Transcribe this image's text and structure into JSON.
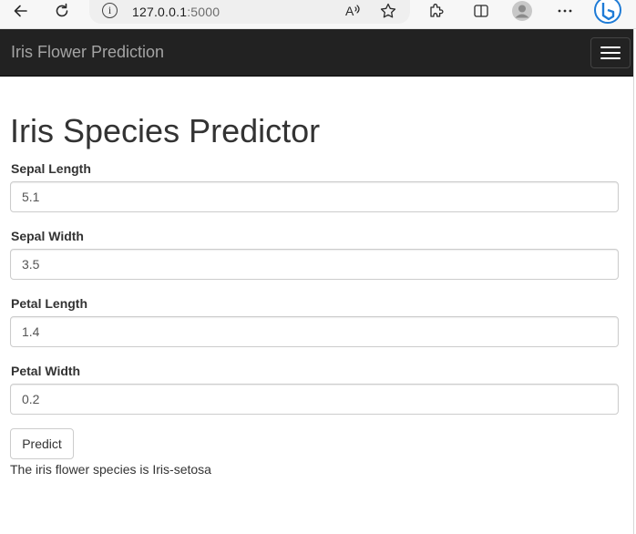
{
  "browser": {
    "url_host": "127.0.0.1",
    "url_port": ":5000",
    "icons": [
      "back-icon",
      "reload-icon",
      "site-info-icon",
      "read-aloud-icon",
      "favorite-icon",
      "extensions-icon",
      "split-screen-icon",
      "profile-icon",
      "more-icon",
      "copilot-icon"
    ]
  },
  "navbar": {
    "brand": "Iris Flower Prediction",
    "toggle_icon": "hamburger-menu-icon"
  },
  "main": {
    "title": "Iris Species Predictor",
    "fields": [
      {
        "label": "Sepal Length",
        "value": "5.1"
      },
      {
        "label": "Sepal Width",
        "value": "3.5"
      },
      {
        "label": "Petal Length",
        "value": "1.4"
      },
      {
        "label": "Petal Width",
        "value": "0.2"
      }
    ],
    "submit_label": "Predict",
    "result": "The iris flower species is Iris-setosa"
  },
  "colors": {
    "navbar_bg": "#222222",
    "brand_text": "#a4a4a4",
    "copilot_blue": "#1e7bd6"
  }
}
